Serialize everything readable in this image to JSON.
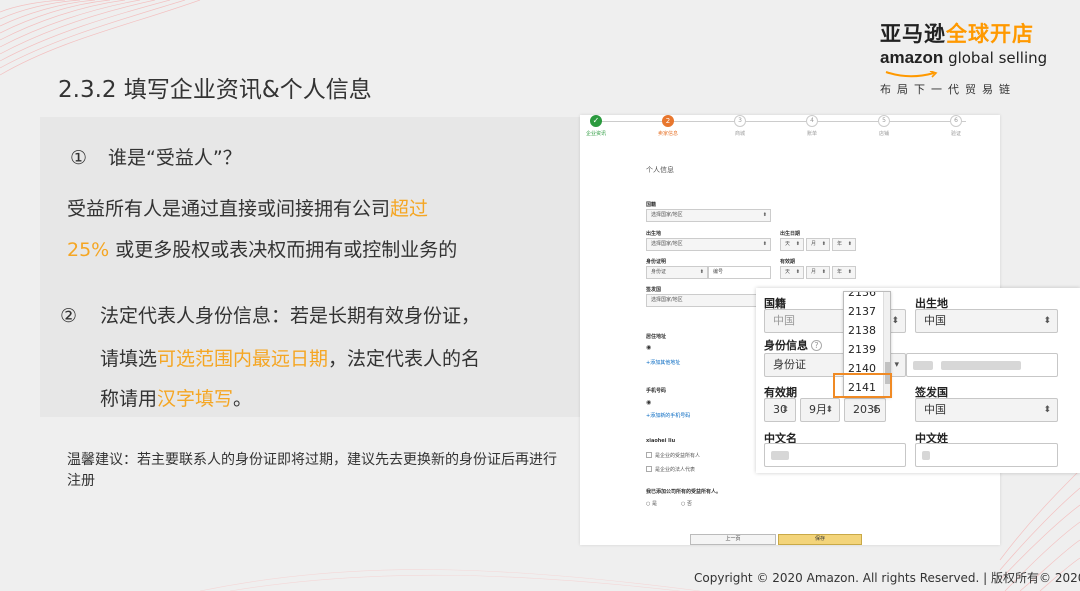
{
  "brand": {
    "cn_black": "亚马逊",
    "cn_orange": "全球开店",
    "en_bold": "amazon",
    "en_light": " global selling",
    "slogan": "布局下一代贸易链",
    "accent_color": "#ff9900"
  },
  "title": "2.3.2 填写企业资讯&个人信息",
  "section1": {
    "number": "①",
    "question": "谁是“受益人”？",
    "line1_pre": "受益所有人是通过直接或间接拥有公司",
    "line1_hl": "超过",
    "line2_hl": "25%",
    "line2_post": " 或更多股权或表决权而拥有或控制业务的"
  },
  "section2": {
    "number": "②",
    "line1": "法定代表人身份信息：若是长期有效身份证，",
    "line2_pre": "请填选",
    "line2_hl": "可选范围内最远日期",
    "line2_post": "，法定代表人的名",
    "line3_pre": "称请用",
    "line3_hl": "汉字填写",
    "line3_post": "。"
  },
  "tip": "温馨建议：若主要联系人的身份证即将过期，建议先去更换新的身份证后再进行注册",
  "form": {
    "steps": [
      {
        "label": "企业资讯",
        "mark": "✓",
        "state": "done"
      },
      {
        "label": "卖家信息",
        "mark": "2",
        "state": "current"
      },
      {
        "label": "商城",
        "mark": "3",
        "state": "todo"
      },
      {
        "label": "账单",
        "mark": "4",
        "state": "todo"
      },
      {
        "label": "店铺",
        "mark": "5",
        "state": "todo"
      },
      {
        "label": "验证",
        "mark": "6",
        "state": "todo"
      }
    ],
    "section_title": "个人信息",
    "nationality_label": "国籍",
    "birthplace_label": "出生地",
    "dob_label": "出生日期",
    "id_label": "身份证明",
    "expiry_label": "有效期",
    "issuer_label": "签发国",
    "select_country": "选择国家/地区",
    "day_ph": "天",
    "month_ph": "月",
    "year_ph": "年",
    "id_type": "身份证",
    "id_number_ph": "编号",
    "address_label": "居住地址",
    "add_address": "+添加其他地址",
    "phone_label": "手机号码",
    "add_phone": "+添加新的手机号码",
    "name_heading": "xiaohei liu",
    "check1": "是企业的受益所有人",
    "check2": "是企业的法人代表",
    "question": "我已添加公司所有的受益所有人。",
    "opt_yes": "是",
    "opt_no": "否",
    "back_btn": "上一页",
    "save_btn": "保存"
  },
  "zoom": {
    "nationality_label": "国籍",
    "nationality_value": "中国",
    "birthplace_label": "出生地",
    "birthplace_value": "中国",
    "id_label": "身份信息",
    "id_type": "身份证",
    "expiry_label": "有效期",
    "expiry_day": "30",
    "expiry_month": "9月",
    "expiry_year": "2035",
    "issuer_label": "签发国",
    "issuer_value": "中国",
    "given_name_label": "中文名",
    "surname_label": "中文姓",
    "help_mark": "?"
  },
  "year_dropdown": [
    "2136",
    "2137",
    "2138",
    "2139",
    "2140",
    "2141"
  ],
  "highlight_color": "#f08a24",
  "copyright": "Copyright © 2020 Amazon. All rights Reserved. | 版权所有© 2020"
}
